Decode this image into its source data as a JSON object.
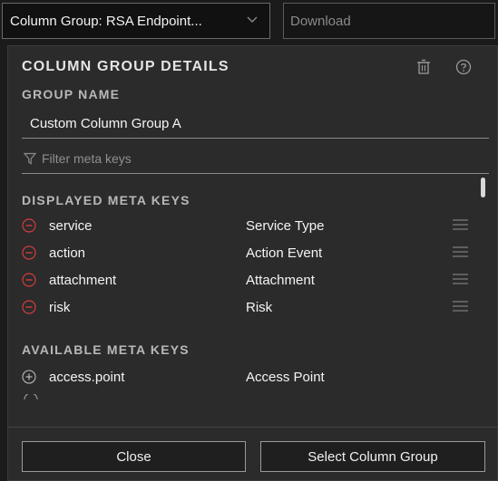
{
  "toolbar": {
    "column_group_value": "Column Group: RSA Endpoint...",
    "download_label": "Download"
  },
  "panel": {
    "title": "COLUMN GROUP DETAILS",
    "group_name_label": "GROUP NAME",
    "group_name_value": "Custom Column Group A",
    "filter_placeholder": "Filter meta keys",
    "displayed_label": "DISPLAYED META KEYS",
    "displayed_keys": [
      {
        "key": "service",
        "display": "Service Type"
      },
      {
        "key": "action",
        "display": "Action Event"
      },
      {
        "key": "attachment",
        "display": "Attachment"
      },
      {
        "key": "risk",
        "display": "Risk"
      }
    ],
    "available_label": "AVAILABLE META KEYS",
    "available_keys": [
      {
        "key": "access.point",
        "display": "Access Point"
      }
    ]
  },
  "footer": {
    "close_label": "Close",
    "select_label": "Select Column Group"
  },
  "colors": {
    "remove_icon": "#d23c3c",
    "panel_bg": "#2b2b2b",
    "page_bg": "#1b1b1b"
  },
  "icons": [
    "chevron-down-icon",
    "filter-icon",
    "trash-icon",
    "help-icon",
    "remove-circle-icon",
    "drag-handle-icon",
    "add-circle-icon"
  ]
}
